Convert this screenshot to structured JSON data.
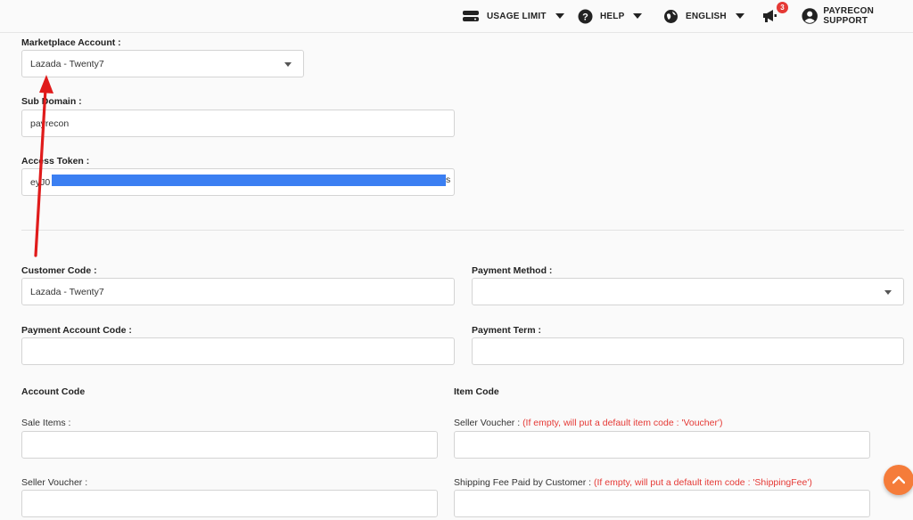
{
  "topbar": {
    "usage_limit": "USAGE LIMIT",
    "help": "HELP",
    "language": "ENGLISH",
    "notification_count": "3",
    "user": "PAYRECON SUPPORT"
  },
  "form": {
    "marketplace_account": {
      "label": "Marketplace Account :",
      "value": "Lazada - Twenty7"
    },
    "sub_domain": {
      "label": "Sub Domain :",
      "value": "payrecon"
    },
    "access_token": {
      "label": "Access Token :",
      "value": "eyJ0",
      "tail": "s"
    },
    "customer_code": {
      "label": "Customer Code :",
      "value": "Lazada - Twenty7"
    },
    "payment_method": {
      "label": "Payment Method :",
      "value": ""
    },
    "payment_account_code": {
      "label": "Payment Account Code :",
      "value": ""
    },
    "payment_term": {
      "label": "Payment Term :",
      "value": ""
    },
    "account_code_heading": "Account Code",
    "item_code_heading": "Item Code",
    "sale_items": {
      "label": "Sale Items :",
      "value": ""
    },
    "seller_voucher_account": {
      "label": "Seller Voucher :",
      "value": ""
    },
    "seller_voucher_item": {
      "label": "Seller Voucher :",
      "hint": "(If empty, will put a default item code : 'Voucher')",
      "value": ""
    },
    "shipping_fee_item": {
      "label": "Shipping Fee Paid by Customer :",
      "hint": "(If empty, will put a default item code : 'ShippingFee')",
      "value": ""
    }
  },
  "colors": {
    "annotation_arrow": "#e01b1b",
    "token_highlight": "#3b7ff2",
    "hint_text": "#e53935",
    "fab": "#f57c3a"
  },
  "icons": [
    "database-icon",
    "help-circle-icon",
    "globe-icon",
    "megaphone-icon",
    "account-circle-icon",
    "chevron-up-icon",
    "dropdown-caret-icon"
  ]
}
